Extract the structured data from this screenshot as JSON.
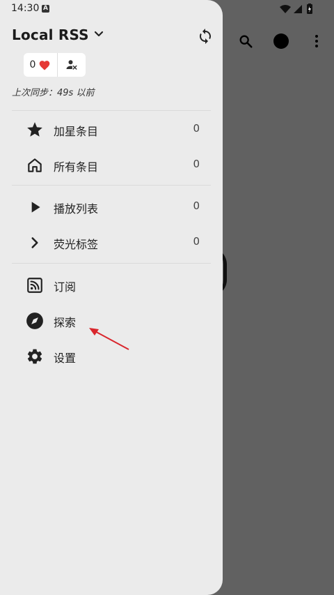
{
  "status_bar": {
    "time": "14:30",
    "notification_badge": "A"
  },
  "drawer": {
    "title": "Local RSS",
    "favorites_count": "0",
    "last_sync": "上次同步：49s 以前",
    "sections": {
      "starred": {
        "label": "加星条目",
        "count": "0"
      },
      "all": {
        "label": "所有条目",
        "count": "0"
      },
      "playlist": {
        "label": "播放列表",
        "count": "0"
      },
      "highlights": {
        "label": "荧光标签",
        "count": "0"
      },
      "subscriptions": {
        "label": "订阅"
      },
      "explore": {
        "label": "探索"
      },
      "settings": {
        "label": "设置"
      }
    }
  },
  "colors": {
    "drawer_bg": "#ebebeb",
    "scrim": "#616161",
    "arrow": "#d9262c",
    "heart": "#e53935"
  }
}
